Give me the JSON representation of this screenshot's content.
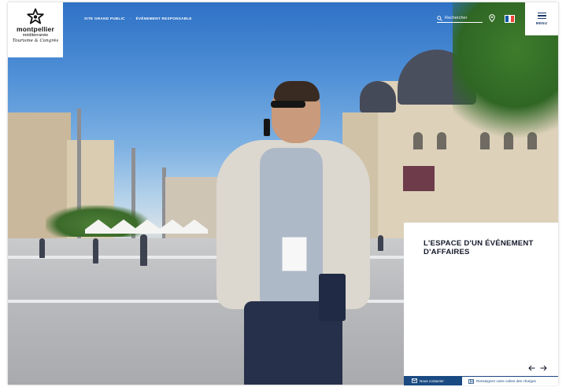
{
  "logo": {
    "name": "montpellier",
    "subtitle": "méditerranée",
    "tagline": "Tourisme & Congrès"
  },
  "topnav": {
    "items": [
      "SITE GRAND PUBLIC",
      "ÉVÉNEMENT RESPONSABLE"
    ],
    "separator": "·"
  },
  "search": {
    "placeholder": "Rechercher",
    "icon": "search-icon"
  },
  "location": {
    "icon": "location-pin-icon"
  },
  "language": {
    "current": "FR",
    "flag_colors": [
      "#0055a4",
      "#ffffff",
      "#ef4135"
    ]
  },
  "menu": {
    "label": "MENU",
    "icon": "hamburger-icon"
  },
  "hero": {
    "heading": "L'ESPACE D'UN ÉVÉNEMENT D'AFFAIRES",
    "prev_icon": "arrow-left-icon",
    "next_icon": "arrow-right-icon"
  },
  "cta": {
    "contact_label": "Nous contacter",
    "contact_icon": "mail-icon",
    "spec_label": "Renseignez votre cahier des charges",
    "spec_icon": "form-icon"
  },
  "colors": {
    "brand_blue": "#1a4a82",
    "panel_text": "#151a2b",
    "menu_blue": "#1b3a6b"
  }
}
